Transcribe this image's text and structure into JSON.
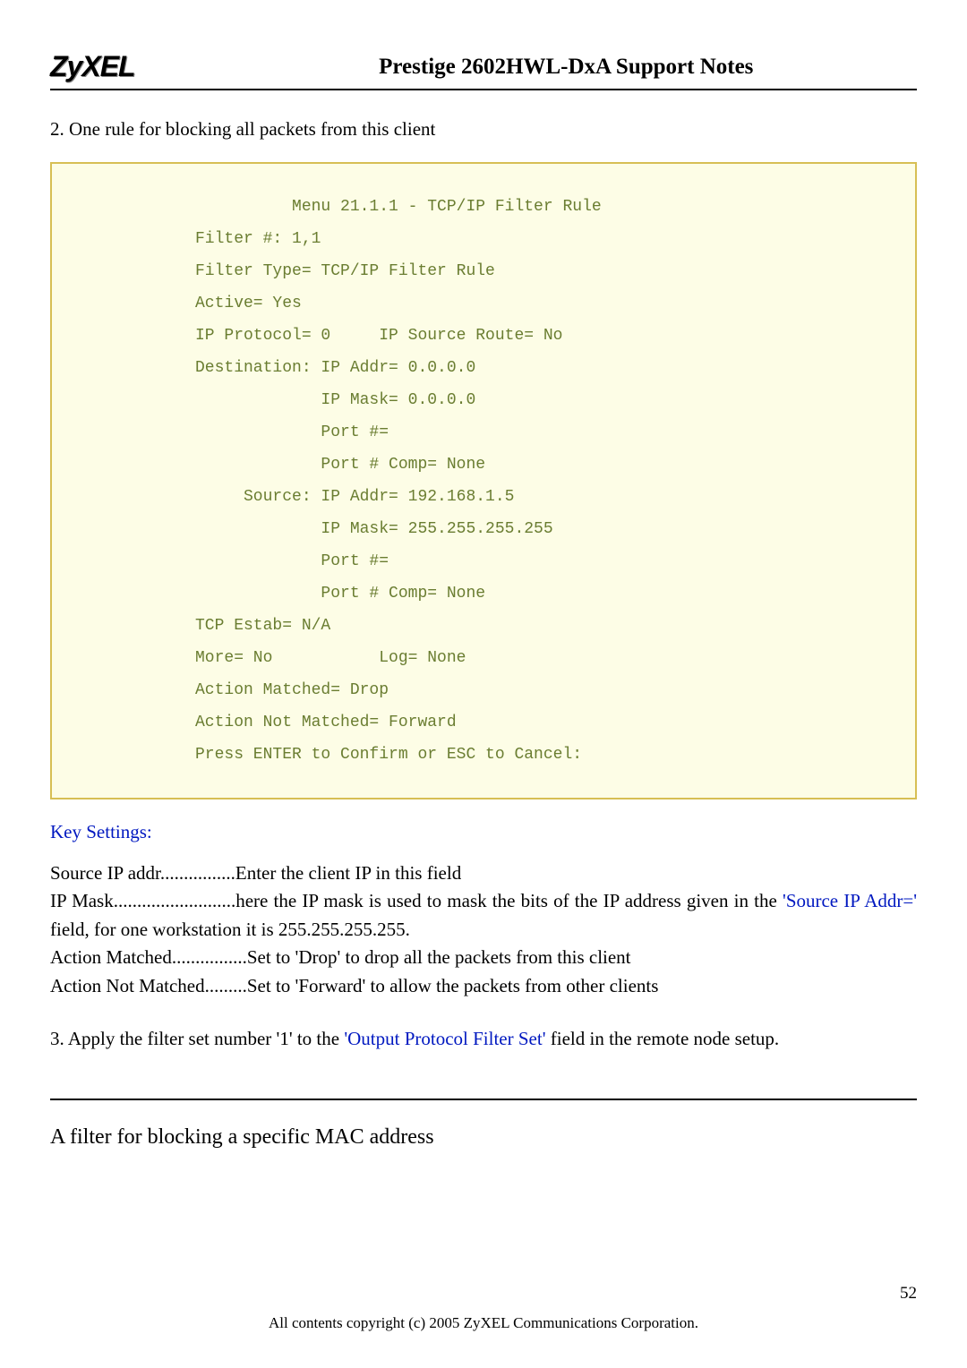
{
  "header": {
    "logo_text": "ZyXEL",
    "title": "Prestige 2602HWL-DxA Support Notes"
  },
  "intro_line": "2. One rule for blocking all packets from this client",
  "codebox": "          Menu 21.1.1 - TCP/IP Filter Rule\nFilter #: 1,1\nFilter Type= TCP/IP Filter Rule\nActive= Yes\nIP Protocol= 0     IP Source Route= No\nDestination: IP Addr= 0.0.0.0\n             IP Mask= 0.0.0.0\n             Port #=\n             Port # Comp= None\n     Source: IP Addr= 192.168.1.5\n             IP Mask= 255.255.255.255\n             Port #=\n             Port # Comp= None\nTCP Estab= N/A\nMore= No           Log= None\nAction Matched= Drop\nAction Not Matched= Forward\nPress ENTER to Confirm or ESC to Cancel:",
  "key_settings_heading": "Key Settings:",
  "key_settings": {
    "line1": "Source IP addr................Enter the client IP in this field",
    "line2_a": "IP Mask..........................here the IP mask is used to mask the bits of the IP address given in the ",
    "line2_blue": "'Source IP Addr='",
    "line2_b": " field, for one workstation it is 255.255.255.255.",
    "line3": "Action Matched................Set to 'Drop' to drop all the packets from this client",
    "line4": "Action Not Matched.........Set to 'Forward' to allow the packets from other clients"
  },
  "apply_line_a": "3. Apply the filter set number '1' to the ",
  "apply_line_blue": "'Output Protocol Filter Set'",
  "apply_line_b": " field in the remote node setup.",
  "subsection_title": "A filter for blocking a specific MAC address",
  "footer_text": "All contents copyright (c) 2005 ZyXEL Communications Corporation.",
  "page_number": "52"
}
